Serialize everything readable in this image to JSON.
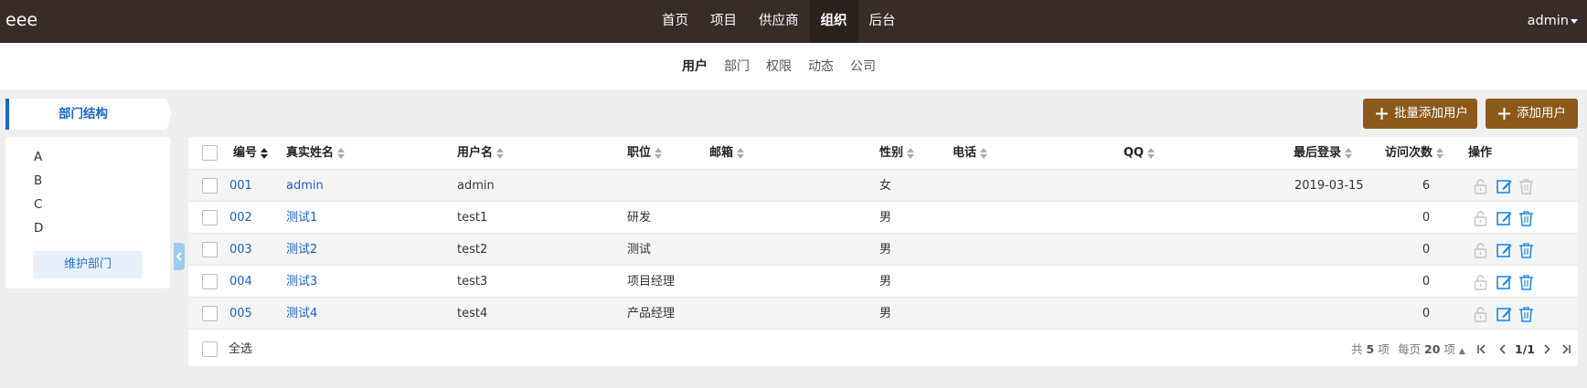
{
  "app": {
    "brand": "eee",
    "user": "admin"
  },
  "main_nav": [
    {
      "label": "首页",
      "active": false
    },
    {
      "label": "项目",
      "active": false
    },
    {
      "label": "供应商",
      "active": false
    },
    {
      "label": "组织",
      "active": true
    },
    {
      "label": "后台",
      "active": false
    }
  ],
  "sub_nav": [
    {
      "label": "用户",
      "active": true
    },
    {
      "label": "部门",
      "active": false
    },
    {
      "label": "权限",
      "active": false
    },
    {
      "label": "动态",
      "active": false
    },
    {
      "label": "公司",
      "active": false
    }
  ],
  "sidebar": {
    "title": "部门结构",
    "departments": [
      "A",
      "B",
      "C",
      "D"
    ],
    "maintain_button": "维护部门"
  },
  "actions": {
    "batch_add": "批量添加用户",
    "add": "添加用户"
  },
  "table": {
    "columns": {
      "id": "编号",
      "realname": "真实姓名",
      "account": "用户名",
      "role": "职位",
      "email": "邮箱",
      "gender": "性别",
      "phone": "电话",
      "qq": "QQ",
      "last_login": "最后登录",
      "visits": "访问次数",
      "ops": "操作"
    },
    "rows": [
      {
        "id": "001",
        "realname": "admin",
        "account": "admin",
        "role": "",
        "email": "",
        "gender": "女",
        "phone": "",
        "qq": "",
        "last_login": "2019-03-15",
        "visits": "6",
        "deletable": false
      },
      {
        "id": "002",
        "realname": "测试1",
        "account": "test1",
        "role": "研发",
        "email": "",
        "gender": "男",
        "phone": "",
        "qq": "",
        "last_login": "",
        "visits": "0",
        "deletable": true
      },
      {
        "id": "003",
        "realname": "测试2",
        "account": "test2",
        "role": "测试",
        "email": "",
        "gender": "男",
        "phone": "",
        "qq": "",
        "last_login": "",
        "visits": "0",
        "deletable": true
      },
      {
        "id": "004",
        "realname": "测试3",
        "account": "test3",
        "role": "项目经理",
        "email": "",
        "gender": "男",
        "phone": "",
        "qq": "",
        "last_login": "",
        "visits": "0",
        "deletable": true
      },
      {
        "id": "005",
        "realname": "测试4",
        "account": "test4",
        "role": "产品经理",
        "email": "",
        "gender": "男",
        "phone": "",
        "qq": "",
        "last_login": "",
        "visits": "0",
        "deletable": true
      }
    ],
    "select_all": "全选"
  },
  "pager": {
    "total_prefix": "共",
    "total": "5",
    "total_suffix": "项",
    "per_page_prefix": "每页",
    "per_page": "20",
    "per_page_suffix": "项",
    "page": "1/1"
  },
  "colors": {
    "topbar": "#372c27",
    "brand_button": "#8b5a1b",
    "link": "#1f5fc8",
    "icon_blue": "#1e88e5",
    "icon_disabled": "#c4c4c4"
  }
}
